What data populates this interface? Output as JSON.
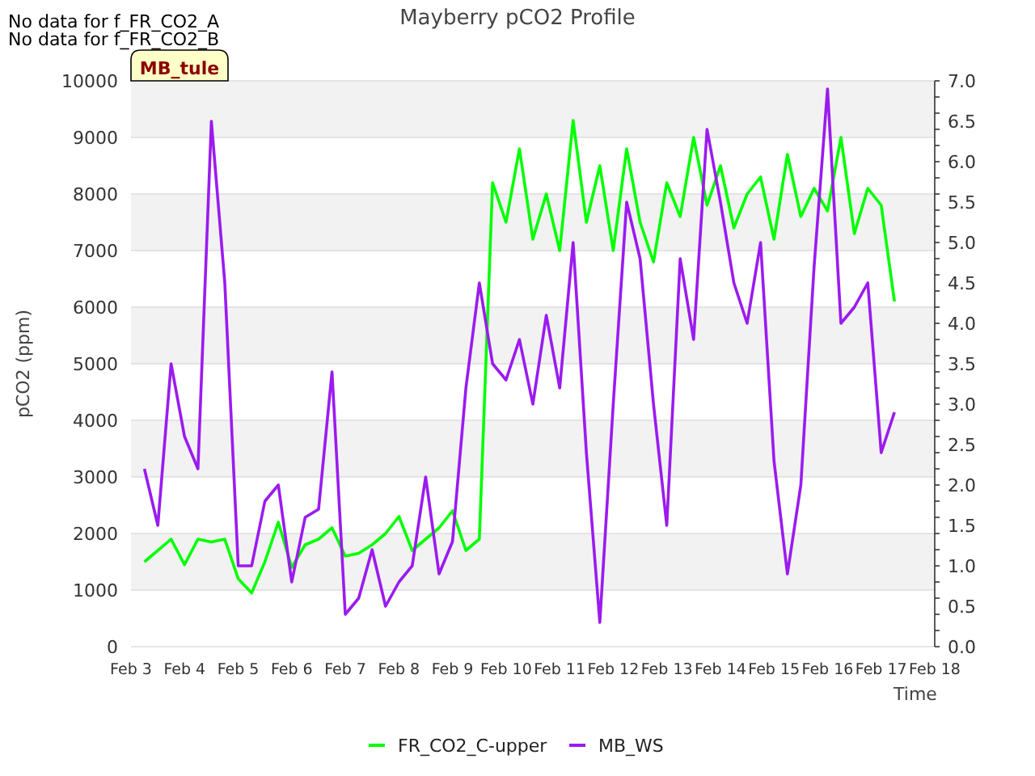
{
  "notices": [
    "No data for f_FR_CO2_A",
    "No data for f_FR_CO2_B"
  ],
  "site_tag": "MB_tule",
  "chart_data": {
    "type": "line",
    "title": "Mayberry pCO2 Profile",
    "xlabel": "Time",
    "ylabel": "pCO2 (ppm)",
    "categories": [
      "Feb 3",
      null,
      null,
      null,
      "Feb 4",
      null,
      null,
      null,
      "Feb 5",
      null,
      null,
      null,
      "Feb 6",
      null,
      null,
      null,
      "Feb 7",
      null,
      null,
      null,
      "Feb 8",
      null,
      null,
      null,
      "Feb 9",
      null,
      null,
      null,
      "Feb 10",
      null,
      null,
      null,
      "Feb 11",
      null,
      null,
      null,
      "Feb 12",
      null,
      null,
      null,
      "Feb 13",
      null,
      null,
      null,
      "Feb 14",
      null,
      null,
      null,
      "Feb 15",
      null,
      null,
      null,
      "Feb 16",
      null,
      null,
      null,
      "Feb 17",
      null,
      null,
      null,
      "Feb 18"
    ],
    "series": [
      {
        "name": "FR_CO2_C-upper",
        "color": "#00ff00",
        "values": [
          null,
          1500,
          1700,
          1900,
          1450,
          1900,
          1850,
          1900,
          1200,
          950,
          1500,
          2200,
          1400,
          1800,
          1900,
          2100,
          1600,
          1650,
          1800,
          2000,
          2300,
          1700,
          1900,
          2100,
          2400,
          1700,
          1900,
          8200,
          7500,
          8800,
          7200,
          8000,
          7000,
          9300,
          7500,
          8500,
          7000,
          8800,
          7500,
          6800,
          8200,
          7600,
          9000,
          7800,
          8500,
          7400,
          8000,
          8300,
          7200,
          8700,
          7600,
          8100,
          7700,
          9000,
          7300,
          8100,
          7800,
          6100,
          null,
          null,
          null
        ]
      },
      {
        "name": "MB_WS",
        "color": "#9b1bef",
        "axis": "y2",
        "values": [
          null,
          2.2,
          1.5,
          3.5,
          2.6,
          2.2,
          6.5,
          4.5,
          1.0,
          1.0,
          1.8,
          2.0,
          0.8,
          1.6,
          1.7,
          3.4,
          0.4,
          0.6,
          1.2,
          0.5,
          0.8,
          1.0,
          2.1,
          0.9,
          1.3,
          3.2,
          4.5,
          3.5,
          3.3,
          3.8,
          3.0,
          4.1,
          3.2,
          5.0,
          2.4,
          0.3,
          3.0,
          5.5,
          4.8,
          3.0,
          1.5,
          4.8,
          3.8,
          6.4,
          5.5,
          4.5,
          4.0,
          5.0,
          2.3,
          0.9,
          2.0,
          4.7,
          6.9,
          4.0,
          4.2,
          4.5,
          2.4,
          2.9,
          null,
          null,
          null
        ]
      }
    ],
    "grid": true,
    "legend": "bottom",
    "ylim": [
      0,
      10000
    ],
    "y2lim": [
      0,
      7
    ],
    "yticks": [
      0,
      1000,
      2000,
      3000,
      4000,
      5000,
      6000,
      7000,
      8000,
      9000,
      10000
    ],
    "y2ticks": [
      {
        "value": 0,
        "label": "0.0"
      },
      {
        "value": 0.5,
        "label": "0.5"
      },
      {
        "value": 1,
        "label": "1.0"
      },
      {
        "value": 1.5,
        "label": "1.5"
      },
      {
        "value": 2,
        "label": "2.0"
      },
      {
        "value": 2.5,
        "label": "2.5"
      },
      {
        "value": 3,
        "label": "3.0"
      },
      {
        "value": 3.5,
        "label": "3.5"
      },
      {
        "value": 4,
        "label": "4.0"
      },
      {
        "value": 4.5,
        "label": "4.5"
      },
      {
        "value": 5,
        "label": "5.0"
      },
      {
        "value": 5.5,
        "label": "5.5"
      },
      {
        "value": 6,
        "label": "6.0"
      },
      {
        "value": 6.5,
        "label": "6.5"
      },
      {
        "value": 7,
        "label": "7.0"
      }
    ]
  }
}
